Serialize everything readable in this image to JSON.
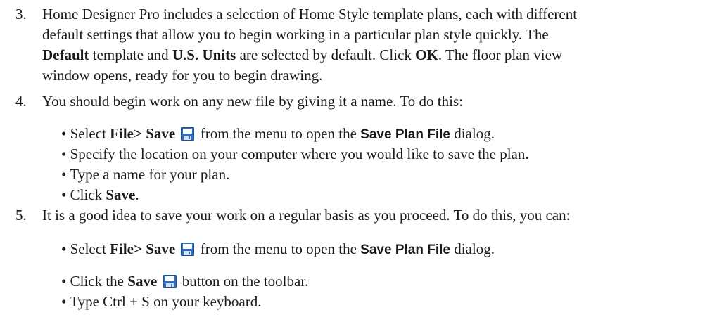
{
  "step3": {
    "number": "3.",
    "line1": "Home Designer Pro includes a selection of Home Style template plans, each with different",
    "line2": "default settings that allow you to begin working in a particular plan style quickly. The",
    "l3_default": "Default",
    "l3_a": " template and ",
    "l3_units": "U.S. Units",
    "l3_b": " are selected by default. Click ",
    "l3_ok": "OK",
    "l3_c": ". The floor plan view",
    "line4": "window opens, ready for you to begin drawing."
  },
  "step4": {
    "number": "4.",
    "intro": "You should begin work on any new file by giving it a name. To do this:",
    "b1_pre": "• Select ",
    "b1_cmd": "File> Save",
    "b1_mid": " from the menu to open the ",
    "b1_dialog": "Save Plan File",
    "b1_post": " dialog.",
    "b2": "• Specify the location on your computer where you would like to save the plan.",
    "b3": "• Type a name for your plan.",
    "b4_pre": "• Click ",
    "b4_bold": "Save",
    "b4_post": "."
  },
  "step5": {
    "number": "5.",
    "intro": "It is a good idea to save your work on a regular basis as you proceed. To do this, you can:",
    "b1_pre": "• Select ",
    "b1_cmd": "File> Save",
    "b1_mid": " from the menu to open the ",
    "b1_dialog": "Save Plan File",
    "b1_post": " dialog.",
    "b2_pre": "• Click the ",
    "b2_bold": "Save",
    "b2_post": " button on the toolbar.",
    "b3": "• Type Ctrl + S on your keyboard."
  },
  "icons": {
    "save": "save-icon",
    "accent": "#2f6fbf"
  }
}
